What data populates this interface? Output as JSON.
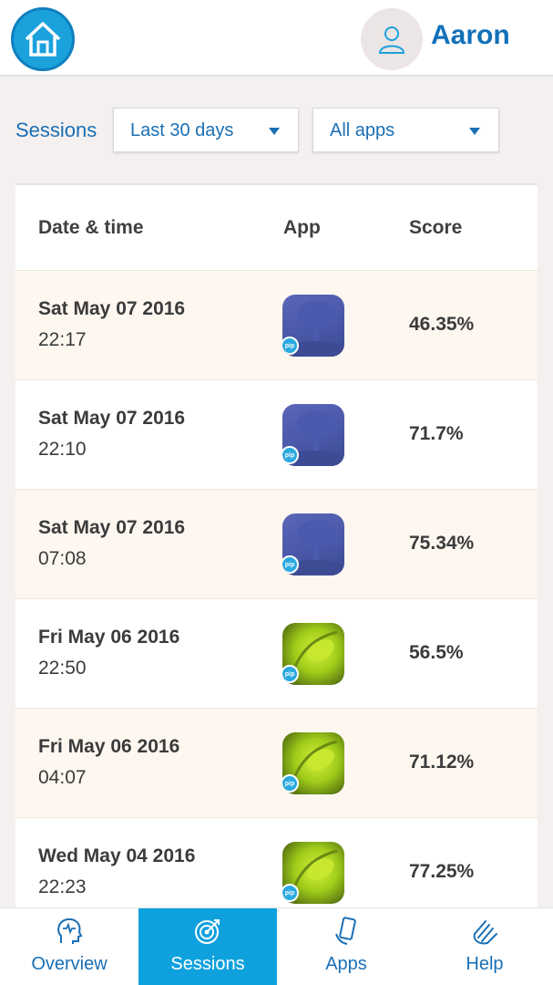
{
  "header": {
    "home_icon": "house-icon",
    "avatar_icon": "user-icon",
    "username": "Aaron"
  },
  "filters": {
    "label": "Sessions",
    "range": "Last 30 days",
    "apps": "All apps"
  },
  "table": {
    "columns": [
      "Date & time",
      "App",
      "Score"
    ],
    "rows": [
      {
        "date": "Sat May 07 2016",
        "time": "22:17",
        "app_icon": "tree-app-icon",
        "score": "46.35%"
      },
      {
        "date": "Sat May 07 2016",
        "time": "22:10",
        "app_icon": "tree-app-icon",
        "score": "71.7%"
      },
      {
        "date": "Sat May 07 2016",
        "time": "07:08",
        "app_icon": "tree-app-icon",
        "score": "75.34%"
      },
      {
        "date": "Fri May 06 2016",
        "time": "22:50",
        "app_icon": "leaf-app-icon",
        "score": "56.5%"
      },
      {
        "date": "Fri May 06 2016",
        "time": "04:07",
        "app_icon": "leaf-app-icon",
        "score": "71.12%"
      },
      {
        "date": "Wed May 04 2016",
        "time": "22:23",
        "app_icon": "leaf-app-icon",
        "score": "77.25%"
      }
    ],
    "pip_badge": "pip"
  },
  "nav": {
    "items": [
      {
        "label": "Overview",
        "icon": "head-icon"
      },
      {
        "label": "Sessions",
        "icon": "target-icon"
      },
      {
        "label": "Apps",
        "icon": "phone-hand-icon"
      },
      {
        "label": "Help",
        "icon": "hand-icon"
      }
    ],
    "active_index": 1
  },
  "colors": {
    "accent": "#1a6fb5",
    "active_tab": "#0fa1dd",
    "row_alt": "#fdf7f0",
    "page_bg": "#f4f0ef"
  }
}
